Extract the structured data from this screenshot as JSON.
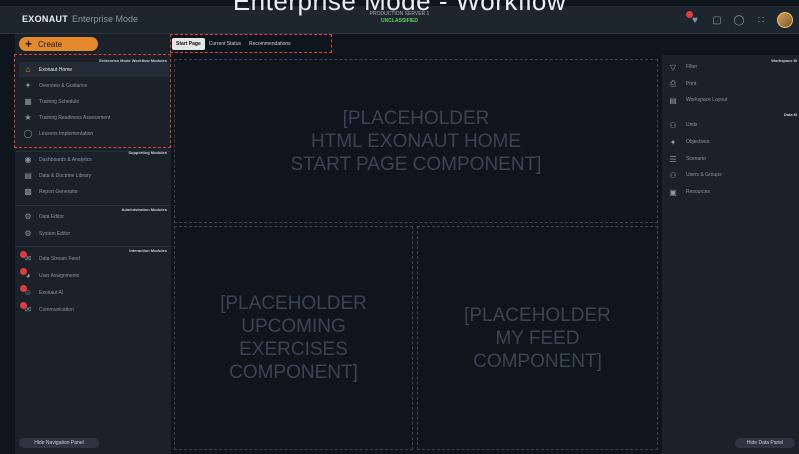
{
  "overlay_title": "Enterprise Mode - Workflow",
  "topbar": {
    "logo": "EXONAUT",
    "mode": "Enterprise Mode",
    "server": "PRODUCTION SERVER 1",
    "classification": "UNCLASSIFIED",
    "icons": [
      "notification-icon",
      "message-icon",
      "help-icon",
      "apps-grid-icon",
      "avatar"
    ]
  },
  "leftnav": {
    "create_label": "Create",
    "sections": [
      {
        "title": "Enterprise Mode Workflow Modules"
      },
      {
        "title": "Supporting Modules"
      },
      {
        "title": "Administration Modules"
      },
      {
        "title": "Interaction Modules"
      }
    ],
    "items": [
      {
        "label": "Exonaut Home",
        "icon": "home-icon"
      },
      {
        "label": "Overview & Guidance",
        "icon": "compass-icon"
      },
      {
        "label": "Training Schedule",
        "icon": "calendar-icon"
      },
      {
        "label": "Training Readiness Assessment",
        "icon": "star-icon"
      },
      {
        "label": "Lessons Implementation",
        "icon": "circle-icon"
      },
      {
        "label": "Dashboards & Analytics",
        "icon": "dashboard-icon"
      },
      {
        "label": "Data & Doctrine Library",
        "icon": "library-icon"
      },
      {
        "label": "Report Generator",
        "icon": "report-icon"
      },
      {
        "label": "Data Editor",
        "icon": "gear-icon"
      },
      {
        "label": "System Editor",
        "icon": "cogs-icon"
      },
      {
        "label": "Data Stream Feed",
        "icon": "feed-icon"
      },
      {
        "label": "User Assignments",
        "icon": "assignment-icon"
      },
      {
        "label": "Exonaut AI",
        "icon": "ai-icon"
      },
      {
        "label": "Communication",
        "icon": "chat-icon"
      }
    ],
    "hide_label": "Hide Navigation Panel"
  },
  "tabs": [
    {
      "label": "Start Page",
      "active": true
    },
    {
      "label": "Current Status",
      "active": false
    },
    {
      "label": "Recommendations",
      "active": false
    }
  ],
  "main": {
    "top_panel": "[PLACEHOLDER\nHTML EXONAUT HOME\nSTART PAGE COMPONENT]",
    "left_panel": "[PLACEHOLDER\nUPCOMING\nEXERCISES\nCOMPONENT]",
    "right_panel": "[PLACEHOLDER\nMY FEED\nCOMPONENT]"
  },
  "rightbar": {
    "section1": "Workspace M",
    "section2": "Data M",
    "items": [
      {
        "label": "Filter",
        "icon": "filter-icon"
      },
      {
        "label": "Print",
        "icon": "print-icon"
      },
      {
        "label": "Workspace Layout",
        "icon": "layout-icon"
      },
      {
        "label": "Units",
        "icon": "units-icon"
      },
      {
        "label": "Objectives",
        "icon": "objectives-icon"
      },
      {
        "label": "Scenario",
        "icon": "scenario-icon"
      },
      {
        "label": "Users & Groups",
        "icon": "users-icon"
      },
      {
        "label": "Resources",
        "icon": "resources-icon"
      }
    ],
    "hide_label": "Hide Data Panel"
  },
  "colors": {
    "accent": "#e48a2a",
    "highlight_box": "#e03a3a",
    "classification": "#5dd05d",
    "background": "#0f151d"
  }
}
